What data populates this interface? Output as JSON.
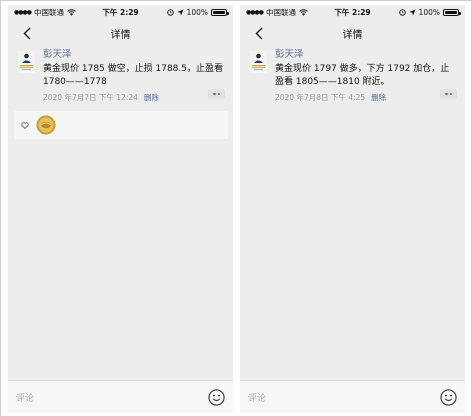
{
  "phones": [
    {
      "status": {
        "carrier": "中国联通",
        "time": "下午 2:29",
        "battery": "100%"
      },
      "nav": {
        "title": "详情"
      },
      "post": {
        "author": "彭天泽",
        "text": "黄金现价 1785 做空，止损 1788.5，止盈看 1780——1778",
        "timestamp": "2020 年7月7日 下午 12:24",
        "delete_label": "删除"
      },
      "likes_visible": true,
      "comment": {
        "placeholder": "评论"
      }
    },
    {
      "status": {
        "carrier": "中国联通",
        "time": "下午 2:29",
        "battery": "100%"
      },
      "nav": {
        "title": "详情"
      },
      "post": {
        "author": "彭天泽",
        "text": "黄金现价 1797 做多，下方 1792 加仓，止盈看 1805——1810 附近。",
        "timestamp": "2020 年7月8日 下午 4:25",
        "delete_label": "删除"
      },
      "likes_visible": false,
      "comment": {
        "placeholder": "评论"
      }
    }
  ],
  "colors": {
    "link": "#576b95",
    "background": "#ededed",
    "likes_bg": "#f5f5f5"
  },
  "icons": [
    "signal-icon",
    "wifi-icon",
    "location-icon",
    "alarm-icon",
    "battery-icon",
    "back-chevron-icon",
    "heart-icon",
    "more-dots-icon",
    "emoji-icon"
  ]
}
